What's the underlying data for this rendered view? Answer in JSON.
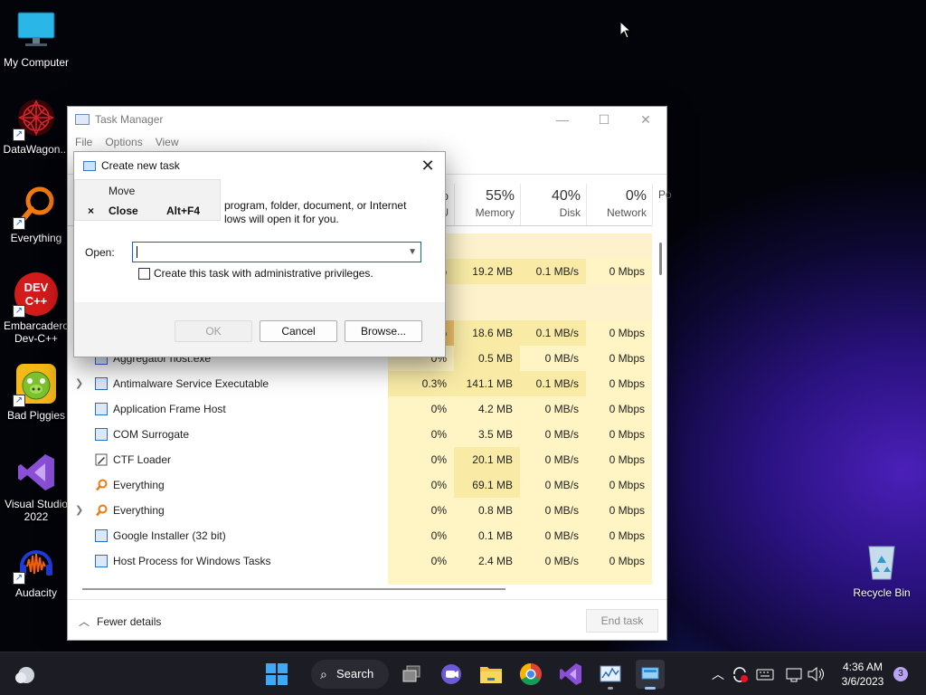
{
  "desktop": {
    "icons": [
      {
        "label": "My Computer"
      },
      {
        "label": "DataWagon..."
      },
      {
        "label": "Everything"
      },
      {
        "label": "Embarcadero Dev-C++"
      },
      {
        "label": "Bad Piggies"
      },
      {
        "label": "Visual Studio 2022"
      },
      {
        "label": "Audacity"
      },
      {
        "label": "Recycle Bin"
      }
    ],
    "devcpp_badge": "DEV C++"
  },
  "task_manager": {
    "title": "Task Manager",
    "menu": [
      "File",
      "Options",
      "View"
    ],
    "columns": [
      {
        "pct": "%",
        "label": "U"
      },
      {
        "pct": "55%",
        "label": "Memory"
      },
      {
        "pct": "40%",
        "label": "Disk"
      },
      {
        "pct": "0%",
        "label": "Network"
      },
      {
        "pct": "",
        "label": "Po"
      }
    ],
    "partial_rows": [
      {
        "cpu": "%",
        "mem": "19.2 MB",
        "disk": "0.1 MB/s",
        "net": "0 Mbps"
      },
      {
        "cpu": "%",
        "mem": "18.6 MB",
        "disk": "0.1 MB/s",
        "net": "0 Mbps"
      }
    ],
    "processes": [
      {
        "name": "Aggregator host.exe",
        "cpu": "0%",
        "mem": "0.5 MB",
        "disk": "0 MB/s",
        "net": "0 Mbps",
        "expand": false
      },
      {
        "name": "Antimalware Service Executable",
        "cpu": "0.3%",
        "mem": "141.1 MB",
        "disk": "0.1 MB/s",
        "net": "0 Mbps",
        "expand": true
      },
      {
        "name": "Application Frame Host",
        "cpu": "0%",
        "mem": "4.2 MB",
        "disk": "0 MB/s",
        "net": "0 Mbps",
        "expand": false
      },
      {
        "name": "COM Surrogate",
        "cpu": "0%",
        "mem": "3.5 MB",
        "disk": "0 MB/s",
        "net": "0 Mbps",
        "expand": false
      },
      {
        "name": "CTF Loader",
        "cpu": "0%",
        "mem": "20.1 MB",
        "disk": "0 MB/s",
        "net": "0 Mbps",
        "expand": false
      },
      {
        "name": "Everything",
        "cpu": "0%",
        "mem": "69.1 MB",
        "disk": "0 MB/s",
        "net": "0 Mbps",
        "expand": false
      },
      {
        "name": "Everything",
        "cpu": "0%",
        "mem": "0.8 MB",
        "disk": "0 MB/s",
        "net": "0 Mbps",
        "expand": true
      },
      {
        "name": "Google Installer (32 bit)",
        "cpu": "0%",
        "mem": "0.1 MB",
        "disk": "0 MB/s",
        "net": "0 Mbps",
        "expand": false
      },
      {
        "name": "Host Process for Windows Tasks",
        "cpu": "0%",
        "mem": "2.4 MB",
        "disk": "0 MB/s",
        "net": "0 Mbps",
        "expand": false
      }
    ],
    "fewer_details": "Fewer details",
    "end_task": "End task"
  },
  "run_dialog": {
    "title": "Create new task",
    "description_line1": "program, folder, document, or Internet",
    "description_line2": "lows will open it for you.",
    "open_label": "Open:",
    "open_value": "",
    "admin_checkbox": "Create this task with administrative privileges.",
    "admin_checked": false,
    "ok": "OK",
    "cancel": "Cancel",
    "browse": "Browse..."
  },
  "context_menu": {
    "move": "Move",
    "close": "Close",
    "close_shortcut": "Alt+F4",
    "close_glyph": "×"
  },
  "taskbar": {
    "search_label": "Search",
    "time": "4:36 AM",
    "date": "3/6/2023",
    "notification_count": "3"
  }
}
